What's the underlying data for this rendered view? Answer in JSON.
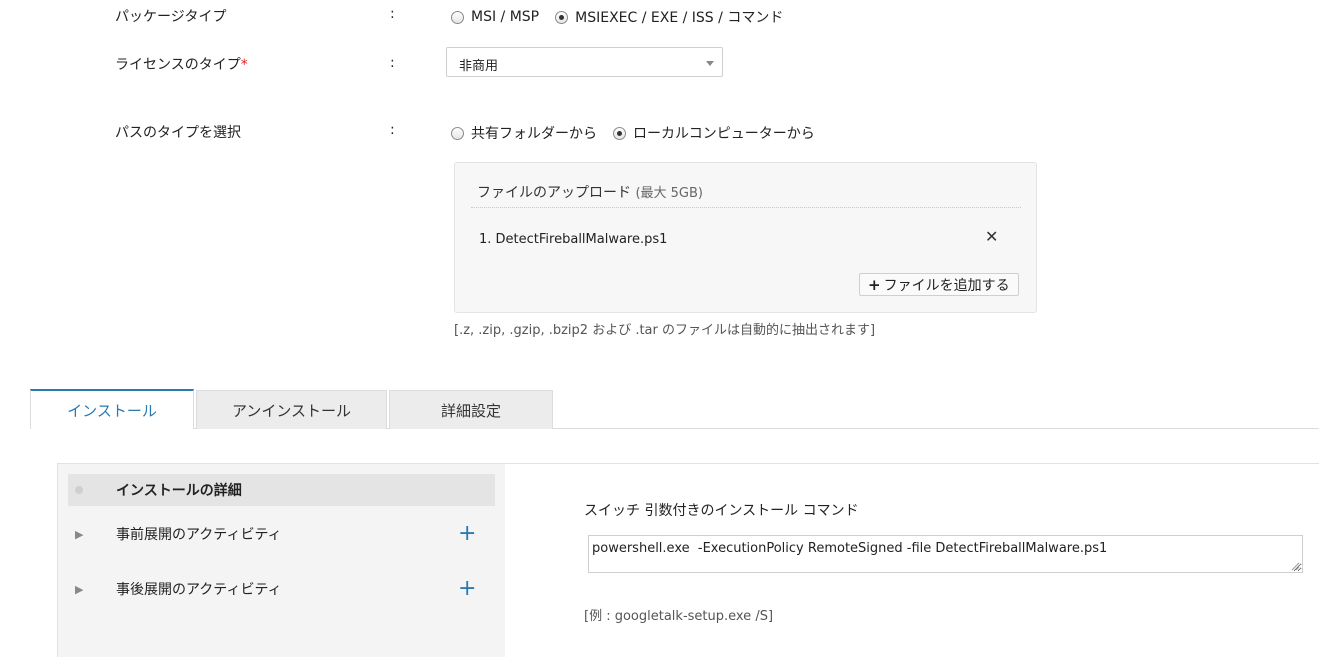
{
  "package_type": {
    "label": "パッケージタイプ",
    "colon": ":",
    "options": [
      {
        "label": "MSI / MSP",
        "checked": false
      },
      {
        "label": "MSIEXEC / EXE / ISS / コマンド",
        "checked": true
      }
    ]
  },
  "license_type": {
    "label": "ライセンスのタイプ",
    "required_mark": "*",
    "colon": ":",
    "selected_value": "非商用"
  },
  "path_type": {
    "label": "パスのタイプを選択",
    "colon": ":",
    "options": [
      {
        "label": "共有フォルダーから",
        "checked": false
      },
      {
        "label": "ローカルコンピューターから",
        "checked": true
      }
    ]
  },
  "upload": {
    "title": "ファイルのアップロード",
    "max_size": "(最大 5GB)",
    "files": [
      {
        "index": "1.",
        "name": "DetectFireballMalware.ps1"
      }
    ],
    "remove_glyph": "✕",
    "add_button_label": "ファイルを追加する",
    "add_button_glyph": "+",
    "hint": "[.z, .zip, .gzip, .bzip2 および .tar のファイルは自動的に抽出されます]"
  },
  "tabs": [
    {
      "label": "インストール",
      "active": true
    },
    {
      "label": "アンインストール",
      "active": false
    },
    {
      "label": "詳細設定",
      "active": false
    }
  ],
  "sidebar": {
    "items": [
      {
        "label": "インストールの詳細",
        "active": true
      },
      {
        "label": "事前展開のアクティビティ",
        "active": false,
        "arrow": "▶",
        "plus": "+"
      },
      {
        "label": "事後展開のアクティビティ",
        "active": false,
        "arrow": "▶",
        "plus": "+"
      }
    ]
  },
  "install": {
    "command_label": "スイッチ 引数付きのインストール コマンド",
    "command_value": "powershell.exe  -ExecutionPolicy RemoteSigned -file DetectFireballMalware.ps1",
    "example": "[例 : googletalk-setup.exe /S]"
  },
  "colors": {
    "accent": "#2a7ab0",
    "required": "#e02020"
  }
}
